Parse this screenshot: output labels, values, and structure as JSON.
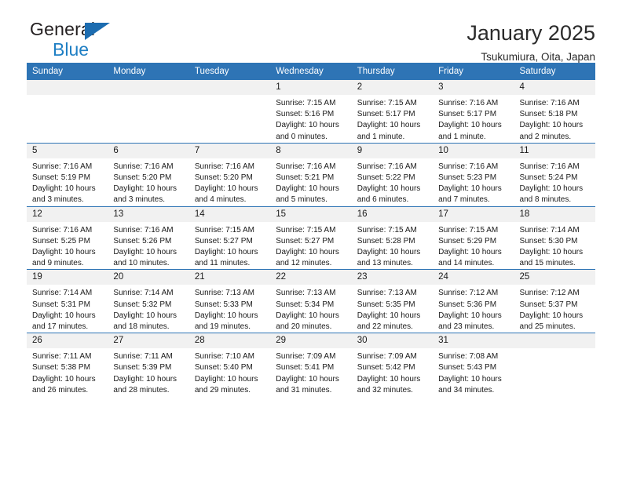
{
  "brand": {
    "line1": "General",
    "line2": "Blue",
    "triangle_icon": "brand-triangle-icon",
    "colors": {
      "general": "#231f20",
      "blue": "#1f7fc4",
      "triangle": "#1c6cb0"
    }
  },
  "header": {
    "title": "January 2025",
    "subtitle": "Tsukumiura, Oita, Japan",
    "accent_color": "#2e74b5",
    "daynum_band_color": "#f1f1f1"
  },
  "weekday_headers": [
    "Sunday",
    "Monday",
    "Tuesday",
    "Wednesday",
    "Thursday",
    "Friday",
    "Saturday"
  ],
  "labels": {
    "sunrise": "Sunrise:",
    "sunset": "Sunset:",
    "daylight": "Daylight:"
  },
  "weeks": [
    [
      {
        "day": "",
        "empty": true
      },
      {
        "day": "",
        "empty": true
      },
      {
        "day": "",
        "empty": true
      },
      {
        "day": "1",
        "sunrise": "Sunrise: 7:15 AM",
        "sunset": "Sunset: 5:16 PM",
        "daylight": "Daylight: 10 hours and 0 minutes."
      },
      {
        "day": "2",
        "sunrise": "Sunrise: 7:15 AM",
        "sunset": "Sunset: 5:17 PM",
        "daylight": "Daylight: 10 hours and 1 minute."
      },
      {
        "day": "3",
        "sunrise": "Sunrise: 7:16 AM",
        "sunset": "Sunset: 5:17 PM",
        "daylight": "Daylight: 10 hours and 1 minute."
      },
      {
        "day": "4",
        "sunrise": "Sunrise: 7:16 AM",
        "sunset": "Sunset: 5:18 PM",
        "daylight": "Daylight: 10 hours and 2 minutes."
      }
    ],
    [
      {
        "day": "5",
        "sunrise": "Sunrise: 7:16 AM",
        "sunset": "Sunset: 5:19 PM",
        "daylight": "Daylight: 10 hours and 3 minutes."
      },
      {
        "day": "6",
        "sunrise": "Sunrise: 7:16 AM",
        "sunset": "Sunset: 5:20 PM",
        "daylight": "Daylight: 10 hours and 3 minutes."
      },
      {
        "day": "7",
        "sunrise": "Sunrise: 7:16 AM",
        "sunset": "Sunset: 5:20 PM",
        "daylight": "Daylight: 10 hours and 4 minutes."
      },
      {
        "day": "8",
        "sunrise": "Sunrise: 7:16 AM",
        "sunset": "Sunset: 5:21 PM",
        "daylight": "Daylight: 10 hours and 5 minutes."
      },
      {
        "day": "9",
        "sunrise": "Sunrise: 7:16 AM",
        "sunset": "Sunset: 5:22 PM",
        "daylight": "Daylight: 10 hours and 6 minutes."
      },
      {
        "day": "10",
        "sunrise": "Sunrise: 7:16 AM",
        "sunset": "Sunset: 5:23 PM",
        "daylight": "Daylight: 10 hours and 7 minutes."
      },
      {
        "day": "11",
        "sunrise": "Sunrise: 7:16 AM",
        "sunset": "Sunset: 5:24 PM",
        "daylight": "Daylight: 10 hours and 8 minutes."
      }
    ],
    [
      {
        "day": "12",
        "sunrise": "Sunrise: 7:16 AM",
        "sunset": "Sunset: 5:25 PM",
        "daylight": "Daylight: 10 hours and 9 minutes."
      },
      {
        "day": "13",
        "sunrise": "Sunrise: 7:16 AM",
        "sunset": "Sunset: 5:26 PM",
        "daylight": "Daylight: 10 hours and 10 minutes."
      },
      {
        "day": "14",
        "sunrise": "Sunrise: 7:15 AM",
        "sunset": "Sunset: 5:27 PM",
        "daylight": "Daylight: 10 hours and 11 minutes."
      },
      {
        "day": "15",
        "sunrise": "Sunrise: 7:15 AM",
        "sunset": "Sunset: 5:27 PM",
        "daylight": "Daylight: 10 hours and 12 minutes."
      },
      {
        "day": "16",
        "sunrise": "Sunrise: 7:15 AM",
        "sunset": "Sunset: 5:28 PM",
        "daylight": "Daylight: 10 hours and 13 minutes."
      },
      {
        "day": "17",
        "sunrise": "Sunrise: 7:15 AM",
        "sunset": "Sunset: 5:29 PM",
        "daylight": "Daylight: 10 hours and 14 minutes."
      },
      {
        "day": "18",
        "sunrise": "Sunrise: 7:14 AM",
        "sunset": "Sunset: 5:30 PM",
        "daylight": "Daylight: 10 hours and 15 minutes."
      }
    ],
    [
      {
        "day": "19",
        "sunrise": "Sunrise: 7:14 AM",
        "sunset": "Sunset: 5:31 PM",
        "daylight": "Daylight: 10 hours and 17 minutes."
      },
      {
        "day": "20",
        "sunrise": "Sunrise: 7:14 AM",
        "sunset": "Sunset: 5:32 PM",
        "daylight": "Daylight: 10 hours and 18 minutes."
      },
      {
        "day": "21",
        "sunrise": "Sunrise: 7:13 AM",
        "sunset": "Sunset: 5:33 PM",
        "daylight": "Daylight: 10 hours and 19 minutes."
      },
      {
        "day": "22",
        "sunrise": "Sunrise: 7:13 AM",
        "sunset": "Sunset: 5:34 PM",
        "daylight": "Daylight: 10 hours and 20 minutes."
      },
      {
        "day": "23",
        "sunrise": "Sunrise: 7:13 AM",
        "sunset": "Sunset: 5:35 PM",
        "daylight": "Daylight: 10 hours and 22 minutes."
      },
      {
        "day": "24",
        "sunrise": "Sunrise: 7:12 AM",
        "sunset": "Sunset: 5:36 PM",
        "daylight": "Daylight: 10 hours and 23 minutes."
      },
      {
        "day": "25",
        "sunrise": "Sunrise: 7:12 AM",
        "sunset": "Sunset: 5:37 PM",
        "daylight": "Daylight: 10 hours and 25 minutes."
      }
    ],
    [
      {
        "day": "26",
        "sunrise": "Sunrise: 7:11 AM",
        "sunset": "Sunset: 5:38 PM",
        "daylight": "Daylight: 10 hours and 26 minutes."
      },
      {
        "day": "27",
        "sunrise": "Sunrise: 7:11 AM",
        "sunset": "Sunset: 5:39 PM",
        "daylight": "Daylight: 10 hours and 28 minutes."
      },
      {
        "day": "28",
        "sunrise": "Sunrise: 7:10 AM",
        "sunset": "Sunset: 5:40 PM",
        "daylight": "Daylight: 10 hours and 29 minutes."
      },
      {
        "day": "29",
        "sunrise": "Sunrise: 7:09 AM",
        "sunset": "Sunset: 5:41 PM",
        "daylight": "Daylight: 10 hours and 31 minutes."
      },
      {
        "day": "30",
        "sunrise": "Sunrise: 7:09 AM",
        "sunset": "Sunset: 5:42 PM",
        "daylight": "Daylight: 10 hours and 32 minutes."
      },
      {
        "day": "31",
        "sunrise": "Sunrise: 7:08 AM",
        "sunset": "Sunset: 5:43 PM",
        "daylight": "Daylight: 10 hours and 34 minutes."
      },
      {
        "day": "",
        "empty": true
      }
    ]
  ]
}
